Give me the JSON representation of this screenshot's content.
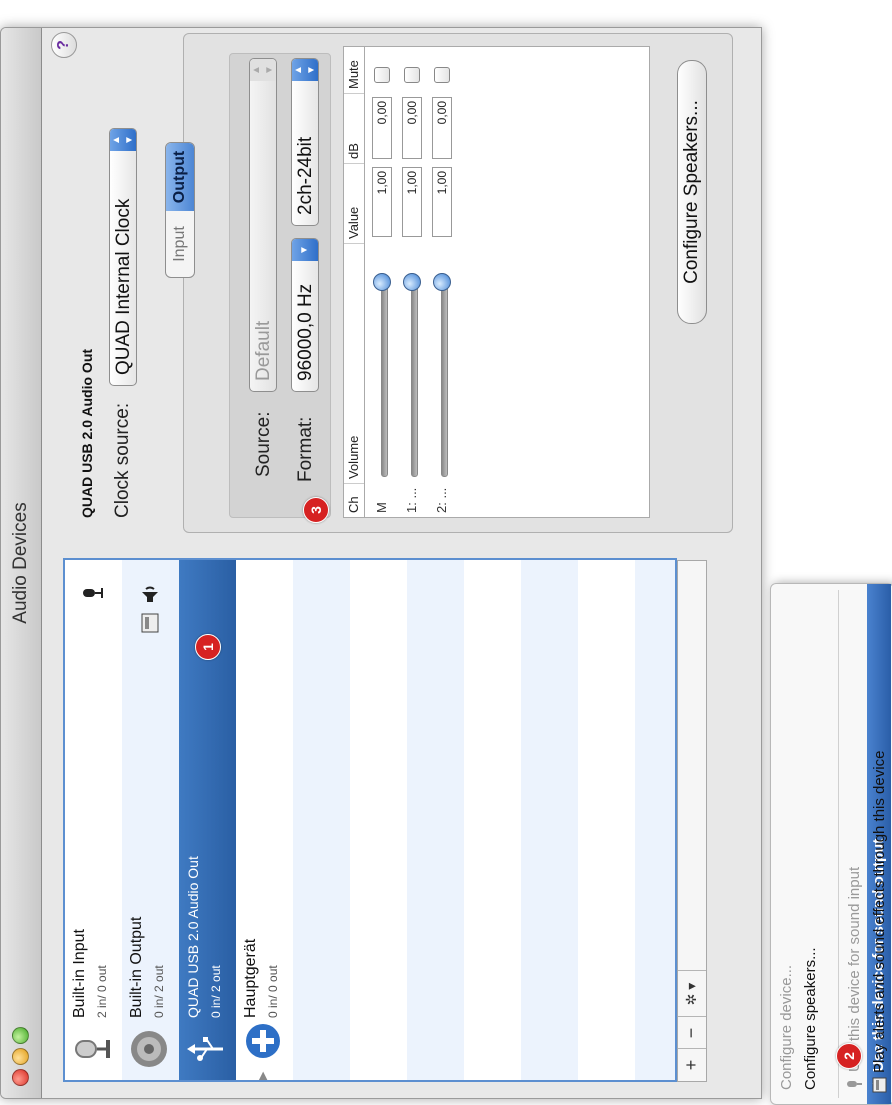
{
  "window": {
    "title": "Audio Devices"
  },
  "devices": [
    {
      "name": "Built-in Input",
      "io": "2 in/ 0 out"
    },
    {
      "name": "Built-in Output",
      "io": "0 in/ 2 out"
    },
    {
      "name": "QUAD USB 2.0 Audio Out",
      "io": "0 in/ 2 out"
    },
    {
      "name": "Hauptgerät",
      "io": "0 in/ 0 out"
    }
  ],
  "toolbar": {
    "add": "+",
    "remove": "−",
    "gear": "✲ ▾"
  },
  "detail": {
    "device_title": "QUAD USB 2.0 Audio Out",
    "clock_label": "Clock source:",
    "clock_value": "QUAD Internal Clock",
    "tab_input": "Input",
    "tab_output": "Output",
    "help": "?",
    "source_label": "Source:",
    "source_value": "Default",
    "format_label": "Format:",
    "format_rate": "96000,0 Hz",
    "format_bits": "2ch-24bit",
    "configure_speakers": "Configure Speakers..."
  },
  "channels": {
    "headers": {
      "ch": "Ch",
      "volume": "Volume",
      "value": "Value",
      "db": "dB",
      "mute": "Mute"
    },
    "rows": [
      {
        "ch": "M",
        "value": "1,00",
        "db": "0,00",
        "level": 1.0
      },
      {
        "ch": "1: ...",
        "value": "1,00",
        "db": "0,00",
        "level": 1.0
      },
      {
        "ch": "2: ...",
        "value": "1,00",
        "db": "0,00",
        "level": 1.0
      }
    ]
  },
  "menu": {
    "configure_device": "Configure device...",
    "configure_speakers": "Configure speakers...",
    "use_input": "Use this device for sound input",
    "use_output": "Use this device for sound output",
    "play_alerts": "Play alerts and sound effects through this device"
  },
  "annotations": {
    "one": "1",
    "two": "2",
    "three": "3"
  },
  "colors": {
    "selection": "#2f66ad",
    "badge": "#d62222",
    "accent": "#4d86d4"
  }
}
